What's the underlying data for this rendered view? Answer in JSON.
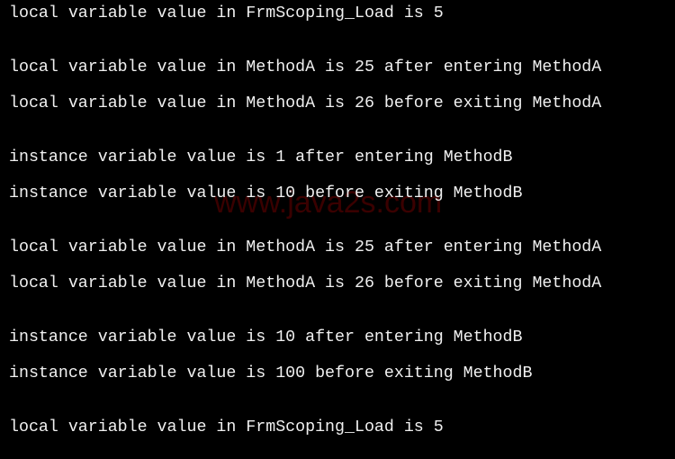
{
  "console": {
    "lines": [
      "local variable value in FrmScoping_Load is 5",
      "local variable value in MethodA is 25 after entering MethodA",
      "local variable value in MethodA is 26 before exiting MethodA",
      "instance variable value is 1 after entering MethodB",
      "instance variable value is 10 before exiting MethodB",
      "local variable value in MethodA is 25 after entering MethodA",
      "local variable value in MethodA is 26 before exiting MethodA",
      "instance variable value is 10 after entering MethodB",
      "instance variable value is 100 before exiting MethodB",
      "local variable value in FrmScoping_Load is 5"
    ],
    "watermark": "www.java2s.com"
  }
}
